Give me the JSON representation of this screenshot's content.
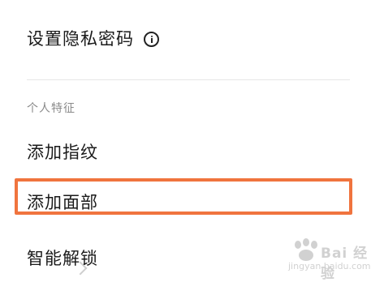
{
  "settings": {
    "password_row_label": "设置隐私密码",
    "section_label": "个人特征",
    "fingerprint_label": "添加指纹",
    "face_label": "添加面部",
    "smart_unlock_label": "智能解锁"
  },
  "highlight_color": "#f0743e",
  "watermark": {
    "brand": "Bai 经验",
    "url": "jingyan.baidu.com"
  }
}
